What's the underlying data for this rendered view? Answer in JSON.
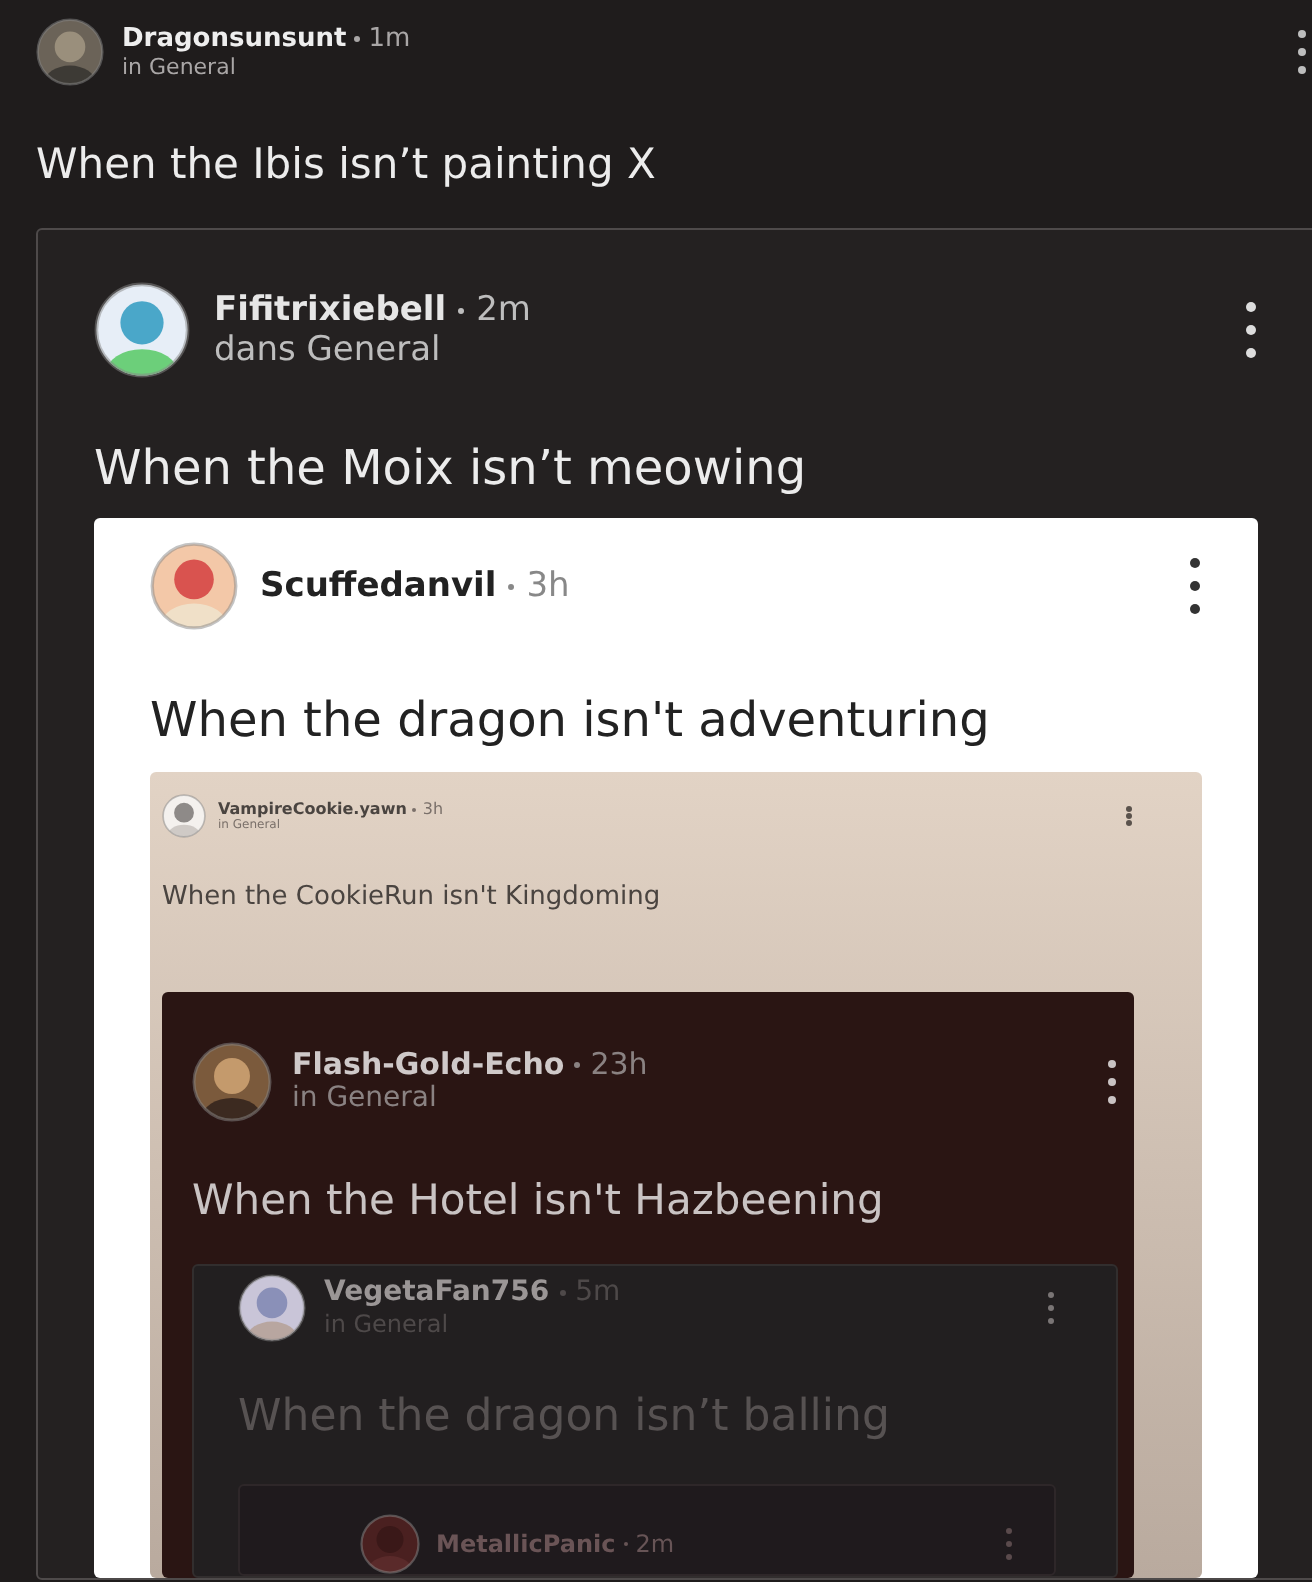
{
  "post": {
    "author": "Dragonsunsunt",
    "time": "1m",
    "community": "in General",
    "title": "When the Ibis isn’t painting X",
    "kind": "dark",
    "embed": {
      "author": "Fifitrixiebell",
      "time": "2m",
      "community": "dans General",
      "title": "When the Moix isn’t meowing",
      "kind": "card-dark",
      "embed": {
        "author": "Scuffedanvil",
        "time": "3h",
        "title": "When the dragon isn't adventuring",
        "kind": "light",
        "embed": {
          "author": "VampireCookie.yawn",
          "time": "3h",
          "community": "in General",
          "title": "When the CookieRun isn't Kingdoming",
          "kind": "beige",
          "embed": {
            "author": "Flash-Gold-Echo",
            "time": "23h",
            "community": "in General",
            "title": "When the Hotel isn't Hazbeening",
            "kind": "maroon",
            "embed": {
              "author": "VegetaFan756",
              "time": "5m",
              "community": "in General",
              "title": "When the dragon isn’t balling",
              "kind": "slate",
              "embed": {
                "author": "MetallicPanic",
                "time": "2m",
                "kind": "faded"
              }
            }
          }
        }
      }
    }
  }
}
